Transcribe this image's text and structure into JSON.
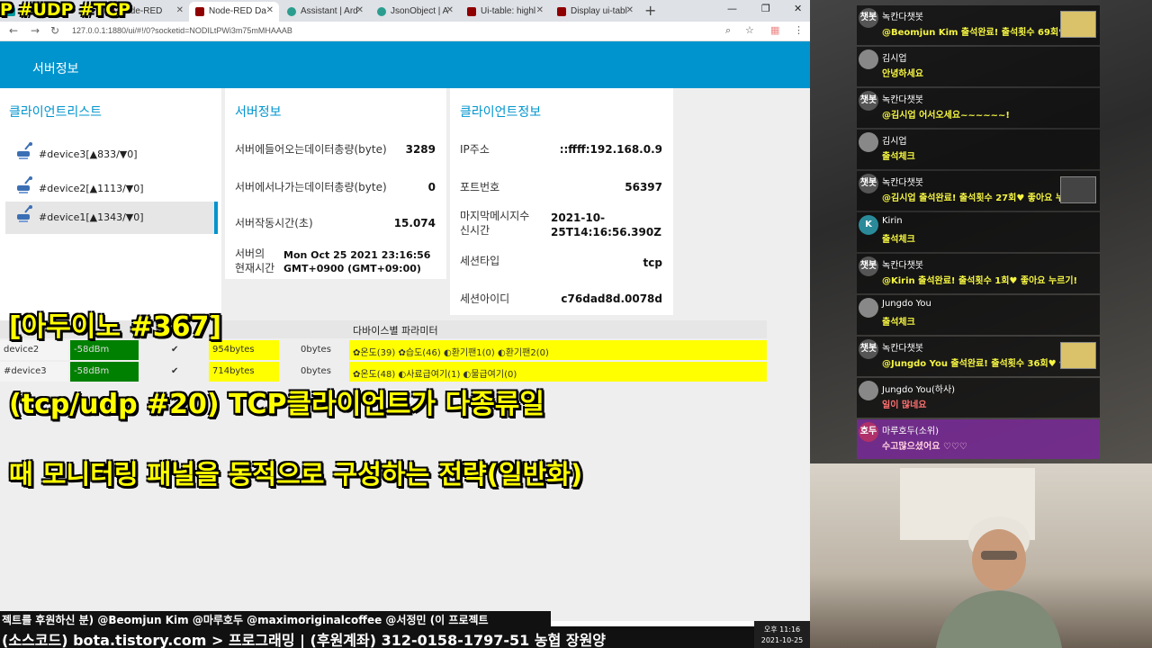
{
  "browser": {
    "tabs": [
      {
        "label": "Arduino - H",
        "color": "#00979d"
      },
      {
        "label": "Node-RED",
        "color": "#8f0000"
      },
      {
        "label": "Node-RED Da",
        "color": "#8f0000",
        "active": true
      },
      {
        "label": "Assistant | Ard",
        "color": "#2a9d8f"
      },
      {
        "label": "JsonObject | A",
        "color": "#2a9d8f"
      },
      {
        "label": "Ui-table: highl",
        "color": "#8f0000"
      },
      {
        "label": "Display ui-tabl",
        "color": "#8f0000"
      }
    ],
    "url": "127.0.0.1:1880/ui/#!/0?socketid=NODILtPWi3m75mMHAAAB"
  },
  "dashboard": {
    "header_title": "서버정보",
    "client_list": {
      "title": "클라이언트리스트",
      "items": [
        "#device3[▲833/▼0]",
        "#device2[▲1113/▼0]",
        "#device1[▲1343/▼0]"
      ]
    },
    "server_info": {
      "title": "서버정보",
      "rows": [
        {
          "label": "서버에들어오는데이터총량(byte)",
          "value": "3289"
        },
        {
          "label": "서버에서나가는데이터총량(byte)",
          "value": "0"
        },
        {
          "label": "서버작동시간(초)",
          "value": "15.074"
        },
        {
          "label": "서버의\n현재시간",
          "value": "Mon Oct 25 2021 23:16:56 GMT+0900 (GMT+09:00)"
        }
      ]
    },
    "client_info": {
      "title": "클라이언트정보",
      "rows": [
        {
          "label": "IP주소",
          "value": "::ffff:192.168.0.9"
        },
        {
          "label": "포트번호",
          "value": "56397"
        },
        {
          "label": "마지막메시지수\n신시간",
          "value": "2021-10-\n25T14:16:56.390Z"
        },
        {
          "label": "세션타입",
          "value": "tcp"
        },
        {
          "label": "세션아이디",
          "value": "c76dad8d.0078d"
        }
      ]
    },
    "table": {
      "param_header": "다바이스별 파라미터",
      "rows": [
        {
          "device": "device2",
          "rssi": "-58dBm",
          "bytes": "954bytes",
          "out": "0bytes",
          "params": "✿온도(39) ✿습도(46) ◐환기팬1(0) ◐환기팬2(0)"
        },
        {
          "device": "#device3",
          "rssi": "-58dBm",
          "bytes": "714bytes",
          "out": "0bytes",
          "params": "✿온도(48) ◐사료급여기(1) ◐물급여기(0)"
        }
      ]
    }
  },
  "overlay": {
    "line1": "[아두이노 #367]",
    "line2": "(tcp/udp #20) TCP클라이언트가 다종류일",
    "line3": "때 모니터링 패널을 동적으로 구성하는 전략(일반화)",
    "corner": "P #UDP #TCP"
  },
  "ticker": {
    "line1": "젝트를 후원하신 분) @Beomjun Kim @마루호두 @maximoriginalcoffee @서정민 (이 프로젝트",
    "line2": "(소스코드) bota.tistory.com > 프로그래밍 | (후원계좌) 312-0158-1797-51 농협 장원양",
    "clock_time": "오후 11:16",
    "clock_date": "2021-10-25"
  },
  "chat": [
    {
      "nick": "녹칸다챗봇",
      "text": "@Beomjun Kim 출석완료! 출석횟수 69회♥ 좋아요 누",
      "avatar": "챗봇",
      "bot": true,
      "badge": true
    },
    {
      "nick": "김시업",
      "text": "안녕하세요",
      "avatar": ""
    },
    {
      "nick": "녹칸다챗봇",
      "text": "@김시업 어서오세요~~~~~~!",
      "avatar": "챗봇",
      "bot": true
    },
    {
      "nick": "김시업",
      "text": "출석체크",
      "avatar": ""
    },
    {
      "nick": "녹칸다챗봇",
      "text": "@김시업 출석완료! 출석횟수 27회♥ 좋아요 누르기!",
      "avatar": "챗봇",
      "bot": true,
      "badge": true
    },
    {
      "nick": "Kirin",
      "text": "출석체크",
      "avatar": "K"
    },
    {
      "nick": "녹칸다챗봇",
      "text": "@Kirin 출석완료! 출석횟수 1회♥ 좋아요 누르기!",
      "avatar": "챗봇",
      "bot": true
    },
    {
      "nick": "Jungdo You",
      "text": "출석체크",
      "avatar": ""
    },
    {
      "nick": "녹칸다챗봇",
      "text": "@Jungdo You 출석완료! 출석횟수 36회♥ 좋아요 누",
      "avatar": "챗봇",
      "bot": true,
      "badge": true
    },
    {
      "nick": "Jungdo You(하사)",
      "text": "일이 많네요",
      "avatar": ""
    },
    {
      "nick": "마루호두(소위)",
      "text": "수고많으셨어요 ♡♡♡",
      "avatar": "호두",
      "pink": true
    }
  ]
}
